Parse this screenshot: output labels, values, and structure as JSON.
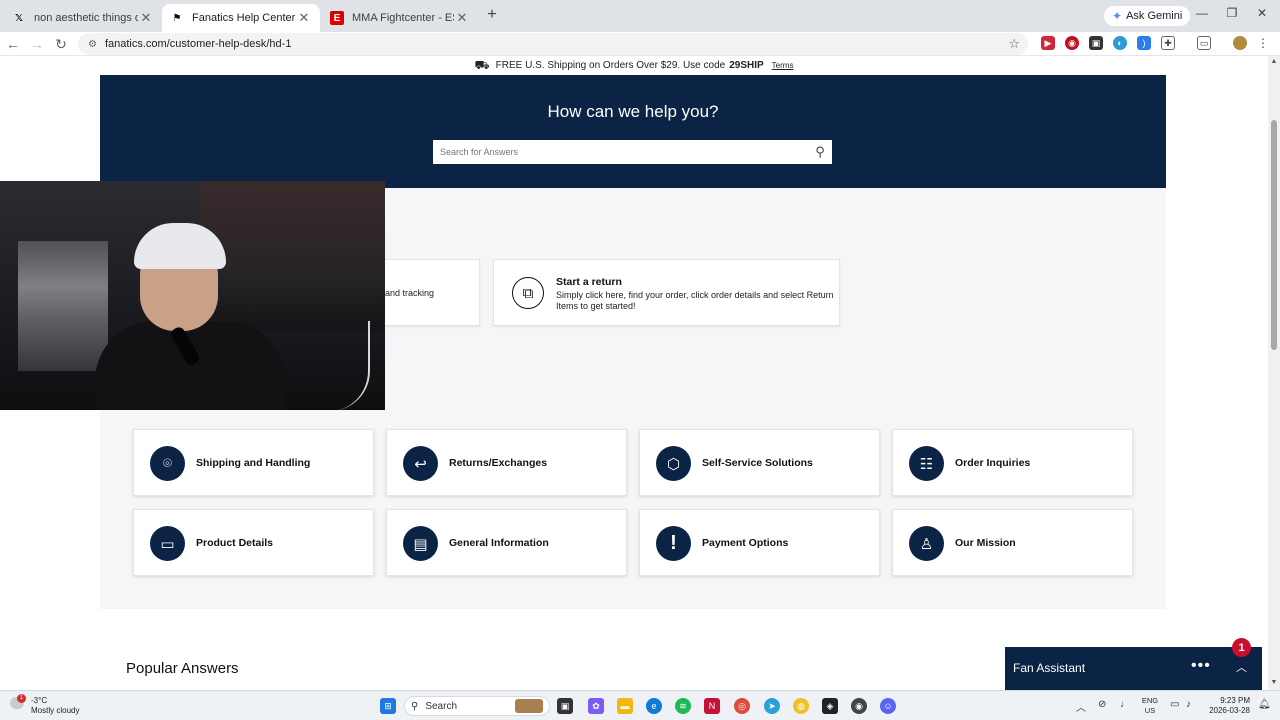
{
  "browser": {
    "tabs": [
      {
        "title": "non aesthetic things on X: \"this",
        "favicon": "X",
        "active": false
      },
      {
        "title": "Fanatics Help Center | Custome",
        "favicon": "F",
        "active": true
      },
      {
        "title": "MMA Fightcenter - ESPN",
        "favicon": "E",
        "active": false
      }
    ],
    "gemini_label": "Ask Gemini",
    "url": "fanatics.com/customer-help-desk/hd-1"
  },
  "promo": {
    "text": "FREE U.S. Shipping on Orders Over $29. Use code",
    "code": "29SHIP",
    "terms": "Terms"
  },
  "hero": {
    "heading": "How can we help you?",
    "search_placeholder": "Search for Answers"
  },
  "quick_actions": [
    {
      "title": "",
      "desc": "and tracking",
      "icon": "tracking-icon"
    },
    {
      "title": "Start a return",
      "desc": "Simply click here, find your order, click order details and select Return Items to get started!",
      "icon": "return-box-icon"
    }
  ],
  "categories": [
    {
      "label": "Shipping and Handling",
      "icon": "location-pin-icon"
    },
    {
      "label": "Returns/Exchanges",
      "icon": "return-arrow-icon"
    },
    {
      "label": "Self-Service Solutions",
      "icon": "box-icon"
    },
    {
      "label": "Order Inquiries",
      "icon": "receipt-icon"
    },
    {
      "label": "Product Details",
      "icon": "tag-icon"
    },
    {
      "label": "General Information",
      "icon": "document-icon"
    },
    {
      "label": "Payment Options",
      "icon": "exclamation-icon"
    },
    {
      "label": "Our Mission",
      "icon": "person-icon"
    }
  ],
  "popular_heading": "Popular Answers",
  "fan_assistant": {
    "title": "Fan Assistant",
    "badge": "1"
  },
  "taskbar": {
    "weather_badge": "1",
    "temperature": "-3°C",
    "condition": "Mostly cloudy",
    "search_label": "Search",
    "lang_top": "ENG",
    "lang_bottom": "US",
    "time": "9:23 PM",
    "date": "2026-03-28"
  },
  "colors": {
    "brand_navy": "#0b2344",
    "page_bg": "#f5f6f8",
    "badge_red": "#c8102e"
  }
}
